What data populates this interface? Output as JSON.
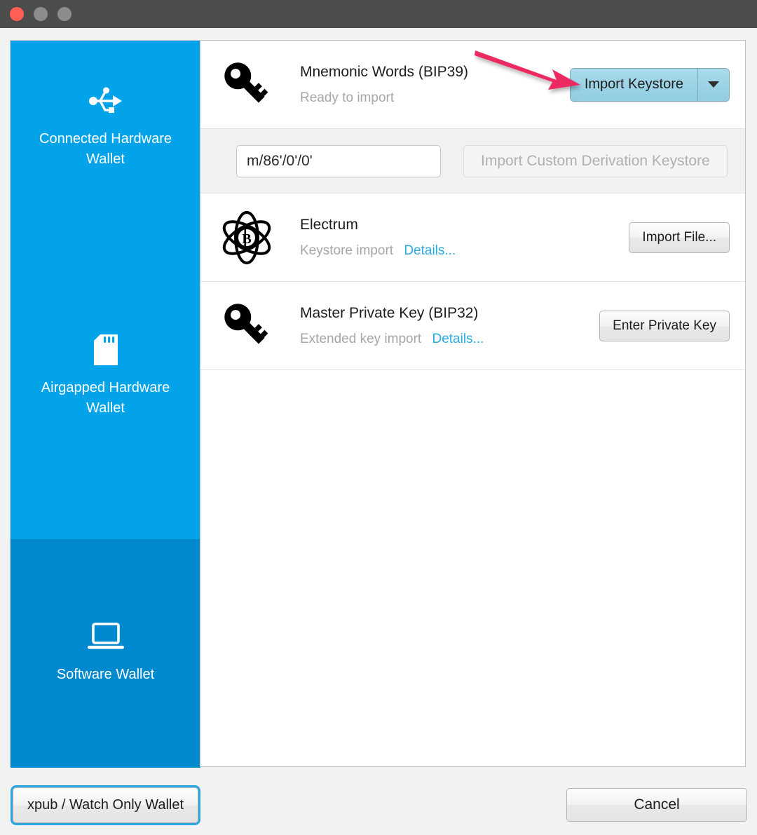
{
  "window": {
    "titlebar_buttons": [
      "close-button",
      "minimize-button",
      "maximize-button"
    ],
    "colors": {
      "titlebar": "#4c4c4c",
      "close": "#ff5f56",
      "minmax": "#8c8c8c",
      "sidebar": "#03a3ea",
      "sidebar_selected": "#0089cf",
      "accent_link": "#29abe2",
      "focus_ring": "#2ba6e0",
      "annotation_arrow": "#ec2b62",
      "primary_button": "#9bd2e5"
    }
  },
  "sidebar": {
    "items": [
      {
        "icon": "usb-icon",
        "label": "Connected Hardware Wallet",
        "selected": false
      },
      {
        "icon": "sdcard-icon",
        "label": "Airgapped Hardware Wallet",
        "selected": false
      },
      {
        "icon": "laptop-icon",
        "label": "Software Wallet",
        "selected": true
      }
    ]
  },
  "main": {
    "rows": [
      {
        "icon": "key-icon",
        "title": "Mnemonic Words (BIP39)",
        "subtitle": "Ready to import",
        "details_link": "",
        "action_label": "Import Keystore",
        "action_type": "split-button",
        "action_caret": "chevron-down-icon"
      },
      {
        "icon": "electrum-atom-icon",
        "title": "Electrum",
        "subtitle": "Keystore import",
        "details_link": "Details...",
        "action_label": "Import File...",
        "action_type": "button"
      },
      {
        "icon": "key-icon",
        "title": "Master Private Key (BIP32)",
        "subtitle": "Extended key import",
        "details_link": "Details...",
        "action_label": "Enter Private Key",
        "action_type": "button"
      }
    ],
    "derivation": {
      "value": "m/86'/0'/0'",
      "placeholder": "m/86'/0'/0'",
      "button_label": "Import Custom Derivation Keystore",
      "button_disabled": true
    }
  },
  "footer": {
    "xpub_label": "xpub / Watch Only Wallet",
    "cancel_label": "Cancel"
  }
}
